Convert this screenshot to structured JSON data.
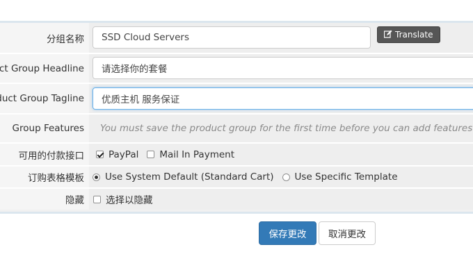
{
  "form": {
    "group_name": {
      "label": "分组名称",
      "value": "SSD Cloud Servers",
      "translate_label": "Translate",
      "translate_icon": "edit-icon"
    },
    "headline": {
      "label": "uct Group Headline",
      "value": "请选择你的套餐"
    },
    "tagline": {
      "label": "duct Group Tagline",
      "value": "优质主机 服务保证"
    },
    "features": {
      "label": "Group Features",
      "note": "You must save the product group for the first time before you can add features"
    },
    "payment": {
      "label": "可用的付款接口",
      "options": [
        {
          "label": "PayPal",
          "checked": true
        },
        {
          "label": "Mail In Payment",
          "checked": false
        }
      ]
    },
    "template": {
      "label": "订购表格模板",
      "options": [
        {
          "label": "Use System Default (Standard Cart)",
          "checked": true
        },
        {
          "label": "Use Specific Template",
          "checked": false
        }
      ]
    },
    "hidden": {
      "label": "隐藏",
      "checkbox_label": "选择以隐藏",
      "checked": false
    }
  },
  "actions": {
    "save_label": "保存更改",
    "cancel_label": "取消更改"
  },
  "colors": {
    "primary": "#337ab7",
    "translate_bg": "#565656",
    "focus_border": "#66afe9"
  }
}
